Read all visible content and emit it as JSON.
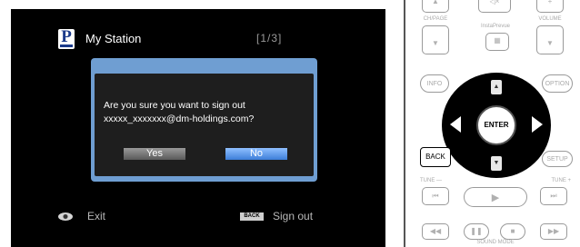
{
  "screen": {
    "logo_letter": "P",
    "station_title": "My Station",
    "page_indicator": "[1/3]",
    "dialog": {
      "message_line1": "Are you sure you want to sign out",
      "message_line2": "xxxxx_xxxxxxx@dm-holdings.com?",
      "yes_label": "Yes",
      "no_label": "No"
    },
    "footer": {
      "exit_label": "Exit",
      "back_badge": "BACK",
      "signout_label": "Sign out"
    }
  },
  "remote": {
    "ch_page_label": "CH/PAGE",
    "instaprevue_label": "InstaPrevue",
    "volume_label": "VOLUME",
    "info_label": "INFO",
    "option_label": "OPTION",
    "enter_label": "ENTER",
    "back_label": "BACK",
    "setup_label": "SETUP",
    "tune_minus_label": "TUNE —",
    "tune_plus_label": "TUNE +",
    "sound_mode_label": "SOUND MODE"
  },
  "colors": {
    "dialog_border": "#6f9ed2",
    "selected_button": "#3d7ed8",
    "screen_background": "#000000"
  }
}
